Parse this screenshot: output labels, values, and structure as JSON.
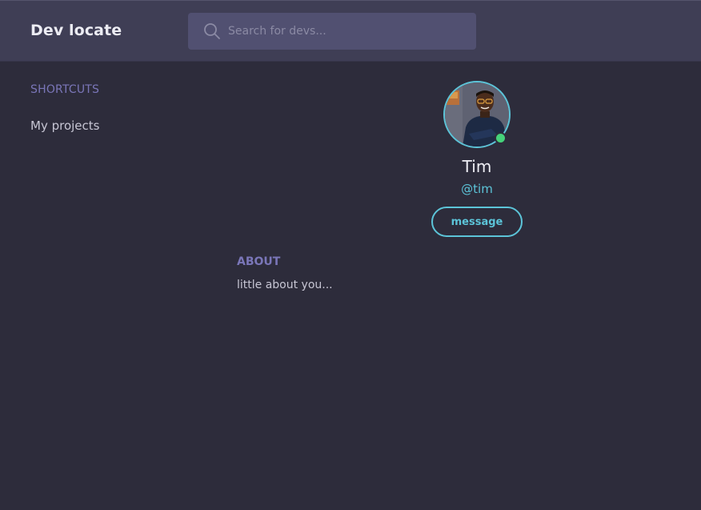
{
  "header": {
    "brand": "Dev locate",
    "search": {
      "placeholder": "Search for devs...",
      "value": "",
      "icon": "search-icon"
    }
  },
  "sidebar": {
    "heading": "SHORTCUTS",
    "items": [
      {
        "label": "My projects"
      }
    ]
  },
  "profile": {
    "name": "Tim",
    "handle": "@tim",
    "status": "online",
    "message_label": "message"
  },
  "about": {
    "heading": "ABOUT",
    "text": "little about you..."
  },
  "colors": {
    "background": "#2d2c3b",
    "topbar": "#3f3e55",
    "search_bg": "#515071",
    "accent": "#5cc4d8",
    "heading": "#7a76b8",
    "online": "#45d27a"
  }
}
